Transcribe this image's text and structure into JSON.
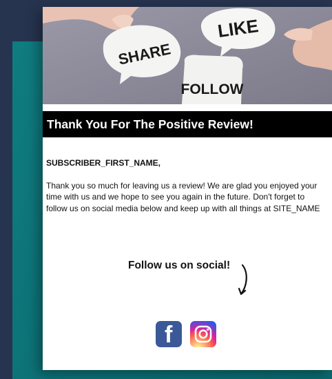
{
  "hero": {
    "bubble_share": "SHARE",
    "bubble_like": "LIKE",
    "bubble_follow": "FOLLOW"
  },
  "email": {
    "title": "Thank You For The Positive Review!",
    "greeting": "SUBSCRIBER_FIRST_NAME,",
    "body": "Thank you so much for leaving us a review! We are glad you enjoyed your time with us and we hope to see you again in the future. Don't forget to follow us on social media below and keep up with all things at SITE_NAME",
    "follow_text": "Follow us on social!"
  },
  "social": {
    "icons": [
      "facebook-icon",
      "instagram-icon"
    ]
  },
  "colors": {
    "page_bg": "#26344f",
    "teal": "#0f7c80",
    "title_bar": "#000000",
    "facebook": "#3b5998"
  }
}
